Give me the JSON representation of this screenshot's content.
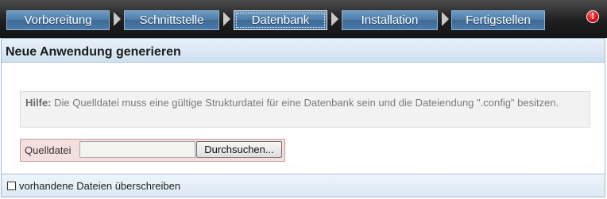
{
  "wizard": {
    "steps": [
      {
        "label": "Vorbereitung"
      },
      {
        "label": "Schnittstelle"
      },
      {
        "label": "Datenbank",
        "active": true
      },
      {
        "label": "Installation"
      },
      {
        "label": "Fertigstellen"
      }
    ],
    "info_icon": "info-icon",
    "info_glyph": "!"
  },
  "panel": {
    "title": "Neue Anwendung generieren"
  },
  "help": {
    "label": "Hilfe:",
    "text": "Die Quelldatei muss eine gültige Strukturdatei für eine Datenbank sein und die Dateiendung \".config\" besitzen."
  },
  "file": {
    "label": "Quelldatei",
    "value": "",
    "browse_label": "Durchsuchen..."
  },
  "overwrite": {
    "label": "vorhandene Dateien überschreiben",
    "checked": false
  },
  "colors": {
    "accent": "#4b7aa6",
    "header_bg": "#cfe0f0",
    "error_bg": "#f4dede"
  }
}
